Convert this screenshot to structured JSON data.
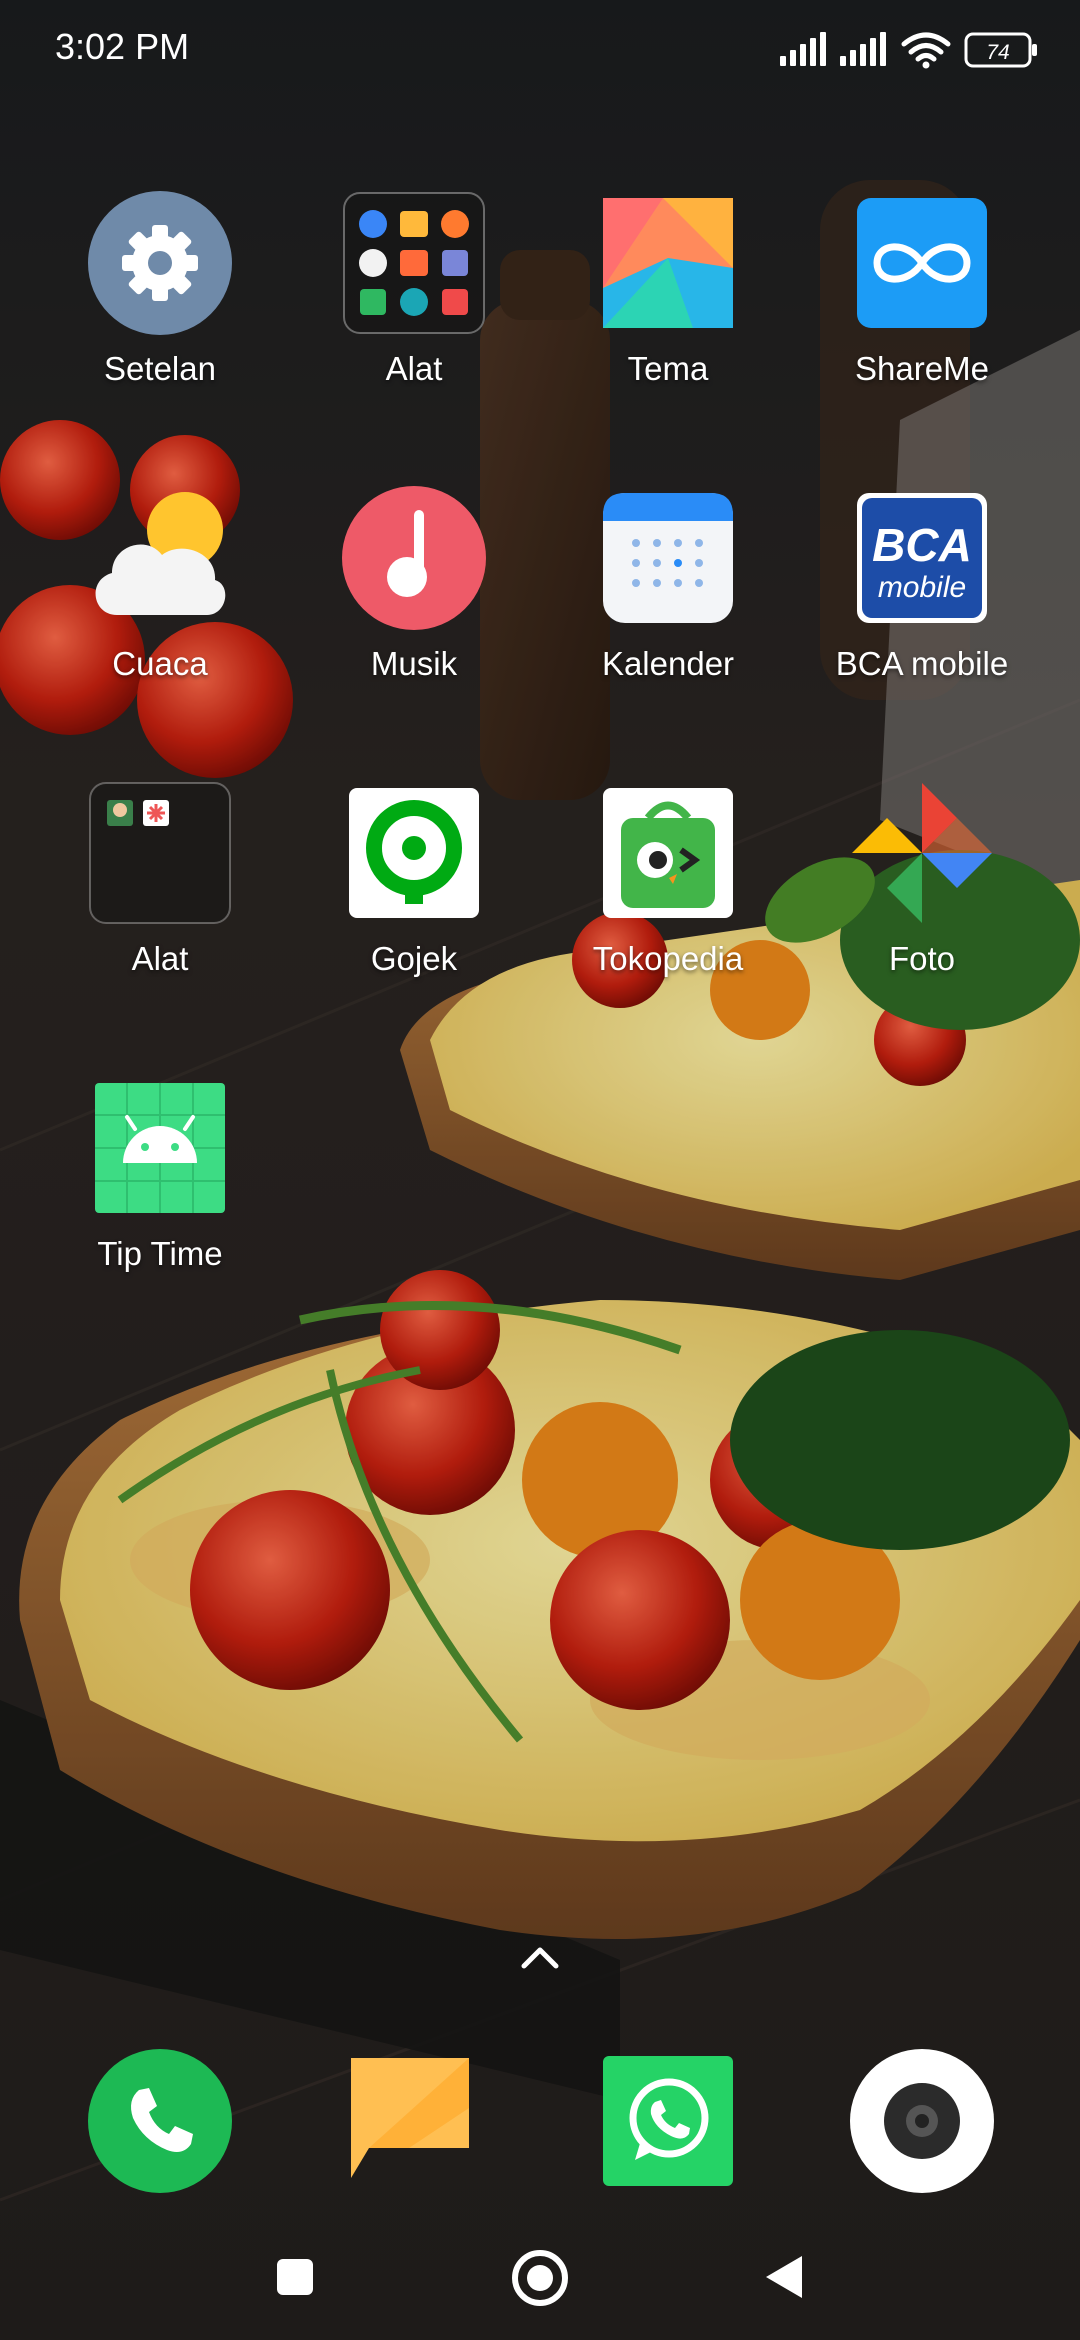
{
  "status_bar": {
    "time": "3:02 PM",
    "battery": "74",
    "icons": [
      "signal-icon",
      "signal-icon",
      "wifi-icon",
      "battery-icon"
    ]
  },
  "apps": [
    {
      "label": "Setelan",
      "icon": "settings-gear-icon"
    },
    {
      "label": "Alat",
      "icon": "tools-folder-icon"
    },
    {
      "label": "Tema",
      "icon": "themes-icon"
    },
    {
      "label": "ShareMe",
      "icon": "shareme-infinity-icon"
    },
    {
      "label": "Cuaca",
      "icon": "weather-cloud-sun-icon"
    },
    {
      "label": "Musik",
      "icon": "music-note-icon"
    },
    {
      "label": "Kalender",
      "icon": "calendar-icon"
    },
    {
      "label": "BCA mobile",
      "icon": "bca-mobile-icon"
    },
    {
      "label": "Alat",
      "icon": "folder-icon"
    },
    {
      "label": "Gojek",
      "icon": "gojek-icon"
    },
    {
      "label": "Tokopedia",
      "icon": "tokopedia-bag-icon"
    },
    {
      "label": "Foto",
      "icon": "photos-pinwheel-icon"
    },
    {
      "label": "Tip Time",
      "icon": "android-robot-icon"
    }
  ],
  "bca_text": {
    "top": "BCA",
    "bottom": "mobile"
  },
  "dock": [
    {
      "icon": "phone-icon"
    },
    {
      "icon": "messages-icon"
    },
    {
      "icon": "whatsapp-icon"
    },
    {
      "icon": "camera-icon"
    }
  ],
  "nav": [
    "recents-square-icon",
    "home-circle-icon",
    "back-triangle-icon"
  ],
  "colors": {
    "settings": "#6f8aa9",
    "music": "#ee5a68",
    "shareme": "#1c9cf6",
    "gojek": "#00aa13",
    "phone": "#1db954",
    "whatsapp": "#25d366",
    "messages": "#ffbf52",
    "tip_time": "#3ddc84"
  }
}
